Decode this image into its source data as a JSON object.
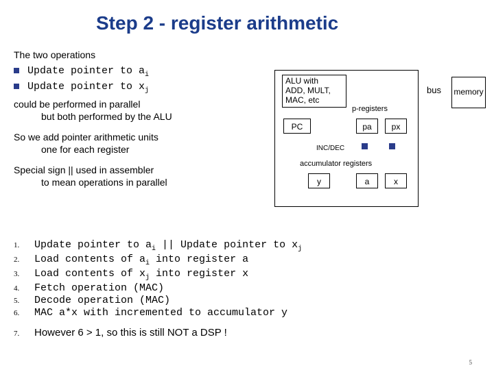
{
  "title": "Step 2 - register arithmetic",
  "intro": "The two operations",
  "bullets": [
    {
      "pre": "Update pointer to a",
      "sub": "i"
    },
    {
      "pre": "Update pointer to x",
      "sub": "j"
    }
  ],
  "text": {
    "could": "could be performed in parallel",
    "but": "but both performed by the ALU",
    "sowe": "So we add pointer arithmetic units",
    "onefor": "one for each register",
    "special1": "Special sign || used in assembler",
    "special2": "to mean operations in parallel"
  },
  "diagram": {
    "alu1": "ALU with",
    "alu2": "ADD, MULT,",
    "alu3": "MAC, etc",
    "preg": "p-registers",
    "pc": "PC",
    "pa": "pa",
    "px": "px",
    "incdec": "INC/DEC",
    "accreg": "accumulator   registers",
    "y": "y",
    "a": "a",
    "x": "x",
    "bus": "bus",
    "memory": "memory"
  },
  "steps": [
    {
      "n": "1.",
      "t": "Update pointer to a",
      "sub": "i",
      "after": " ||  Update pointer to x",
      "sub2": "j"
    },
    {
      "n": "2.",
      "t": "Load contents of a",
      "sub": "i",
      "after": " into register a"
    },
    {
      "n": "3.",
      "t": "Load contents of x",
      "sub": "j",
      "after": " into register x"
    },
    {
      "n": "4.",
      "t": "Fetch operation (MAC)"
    },
    {
      "n": "5.",
      "t": "Decode operation (MAC)"
    },
    {
      "n": "6.",
      "t": "MAC a*x with incremented to accumulator y"
    }
  ],
  "final": {
    "n": "7.",
    "t": "However 6 > 1, so this is still NOT a DSP !"
  },
  "page": "5"
}
